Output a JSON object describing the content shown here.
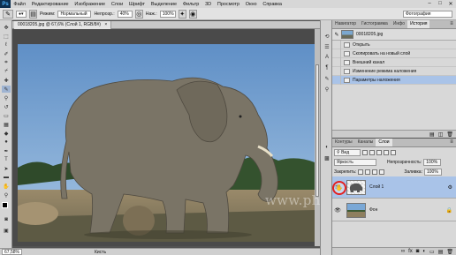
{
  "menubar": {
    "app_logo": "Ps",
    "items": [
      "Файл",
      "Редактирование",
      "Изображение",
      "Слои",
      "Шрифт",
      "Выделение",
      "Фильтр",
      "3D",
      "Просмотр",
      "Окно",
      "Справка"
    ],
    "window_controls": [
      "–",
      "□",
      "✕"
    ]
  },
  "optionsbar": {
    "mode_label": "Режим:",
    "mode_value": "Нормальный",
    "opacity_label": "Непрозр.:",
    "opacity_value": "40%",
    "flow_label": "Наж.:",
    "flow_value": "100%",
    "workspace_value": "Фотография"
  },
  "document": {
    "tab_title": "00018205.jpg @ 67,6% (Слой 1, RGB/8#)",
    "close_glyph": "×"
  },
  "statusbar": {
    "zoom": "67,58%",
    "tool_hint": "Кисть"
  },
  "history_panel": {
    "tabs": [
      "Навигатор",
      "Гистограмма",
      "Инфо",
      "История"
    ],
    "active_tab": "История",
    "snapshot_name": "00018205.jpg",
    "steps": [
      {
        "label": "Открыть",
        "active": false
      },
      {
        "label": "Скопировать на новый слой",
        "active": false
      },
      {
        "label": "Внешний канал",
        "active": false
      },
      {
        "label": "Изменение режима наложения",
        "active": false
      },
      {
        "label": "Параметры наложения",
        "active": true
      }
    ]
  },
  "layers_panel": {
    "tabs": [
      "Контуры",
      "Каналы",
      "Слои"
    ],
    "active_tab": "Слои",
    "filter_value": "Вид",
    "blend_mode": "Яркость",
    "opacity_label": "Непрозрачность:",
    "opacity_value": "100%",
    "lock_label": "Закрепить:",
    "fill_label": "Заливка:",
    "fill_value": "100%",
    "layers": [
      {
        "name": "Слой 1",
        "selected": true,
        "visible": true
      },
      {
        "name": "Фон",
        "selected": false,
        "visible": true,
        "locked": true
      }
    ],
    "mask_marker_icon": "layer-mask-icon"
  },
  "watermark": "www.photoshop-master.ru",
  "colors": {
    "ui_dark": "#535353",
    "panel_bg": "#d8d8d8",
    "selection": "#a9c3e8",
    "highlight_ring": "#e32121",
    "sky": "#7aa8d6"
  }
}
